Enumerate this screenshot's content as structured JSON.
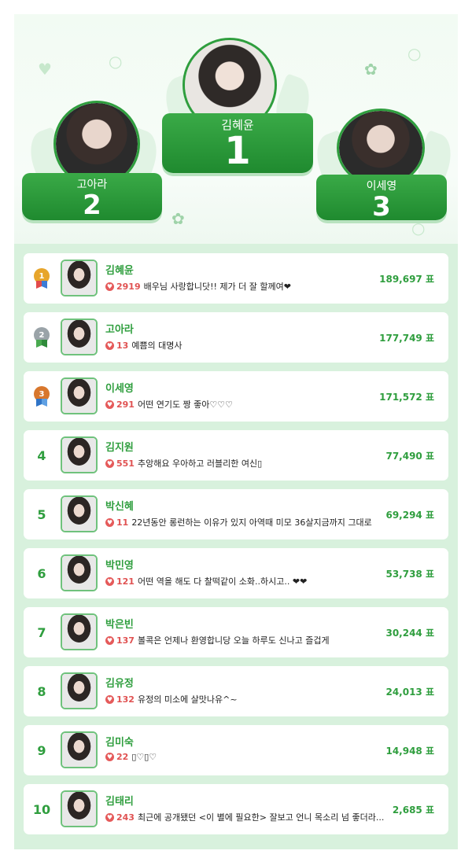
{
  "podium": {
    "first": {
      "name": "김혜윤",
      "rank": "1"
    },
    "second": {
      "name": "고아라",
      "rank": "2"
    },
    "third": {
      "name": "이세영",
      "rank": "3"
    }
  },
  "ranking": [
    {
      "rank": "1",
      "medal": "gold",
      "name": "김혜윤",
      "likes": "2919",
      "comment": "배우님 사랑합니닷!! 제가 더 잘 할께여❤",
      "votes": "189,697 표"
    },
    {
      "rank": "2",
      "medal": "silver",
      "name": "고아라",
      "likes": "13",
      "comment": "예쁨의 대명사",
      "votes": "177,749 표"
    },
    {
      "rank": "3",
      "medal": "bronze",
      "name": "이세영",
      "likes": "291",
      "comment": "어떤 연기도 짱 좋아♡♡♡",
      "votes": "171,572 표"
    },
    {
      "rank": "4",
      "name": "김지원",
      "likes": "551",
      "comment": "추앙해요 우아하고 러블리한 여신▯",
      "votes": "77,490 표"
    },
    {
      "rank": "5",
      "name": "박신혜",
      "likes": "11",
      "comment": "22년동안 롱런하는 이유가 있지 아역때 미모 36살지금까지 그대로",
      "votes": "69,294 표"
    },
    {
      "rank": "6",
      "name": "박민영",
      "likes": "121",
      "comment": "어떤 역을 해도 다 찰떡같이 소화..하시고.. ❤❤",
      "votes": "53,738 표"
    },
    {
      "rank": "7",
      "name": "박은빈",
      "likes": "137",
      "comment": "볼콕은 언제나 환영합니당 오늘 하루도 신나고 즐겁게",
      "votes": "30,244 표"
    },
    {
      "rank": "8",
      "name": "김유정",
      "likes": "132",
      "comment": "유정의 미소에 살맛나유^~",
      "votes": "24,013 표"
    },
    {
      "rank": "9",
      "name": "김미숙",
      "likes": "22",
      "comment": "▯♡▯♡",
      "votes": "14,948 표"
    },
    {
      "rank": "10",
      "name": "김태리",
      "likes": "243",
      "comment": "최근에 공개됐던 <이 별에 필요한> 잘보고 언니 목소리 넘 좋더라...",
      "votes": "2,685 표"
    }
  ],
  "colors": {
    "accent": "#2f9e3e",
    "likes": "#e05252",
    "list_bg": "#d8f1dd"
  }
}
